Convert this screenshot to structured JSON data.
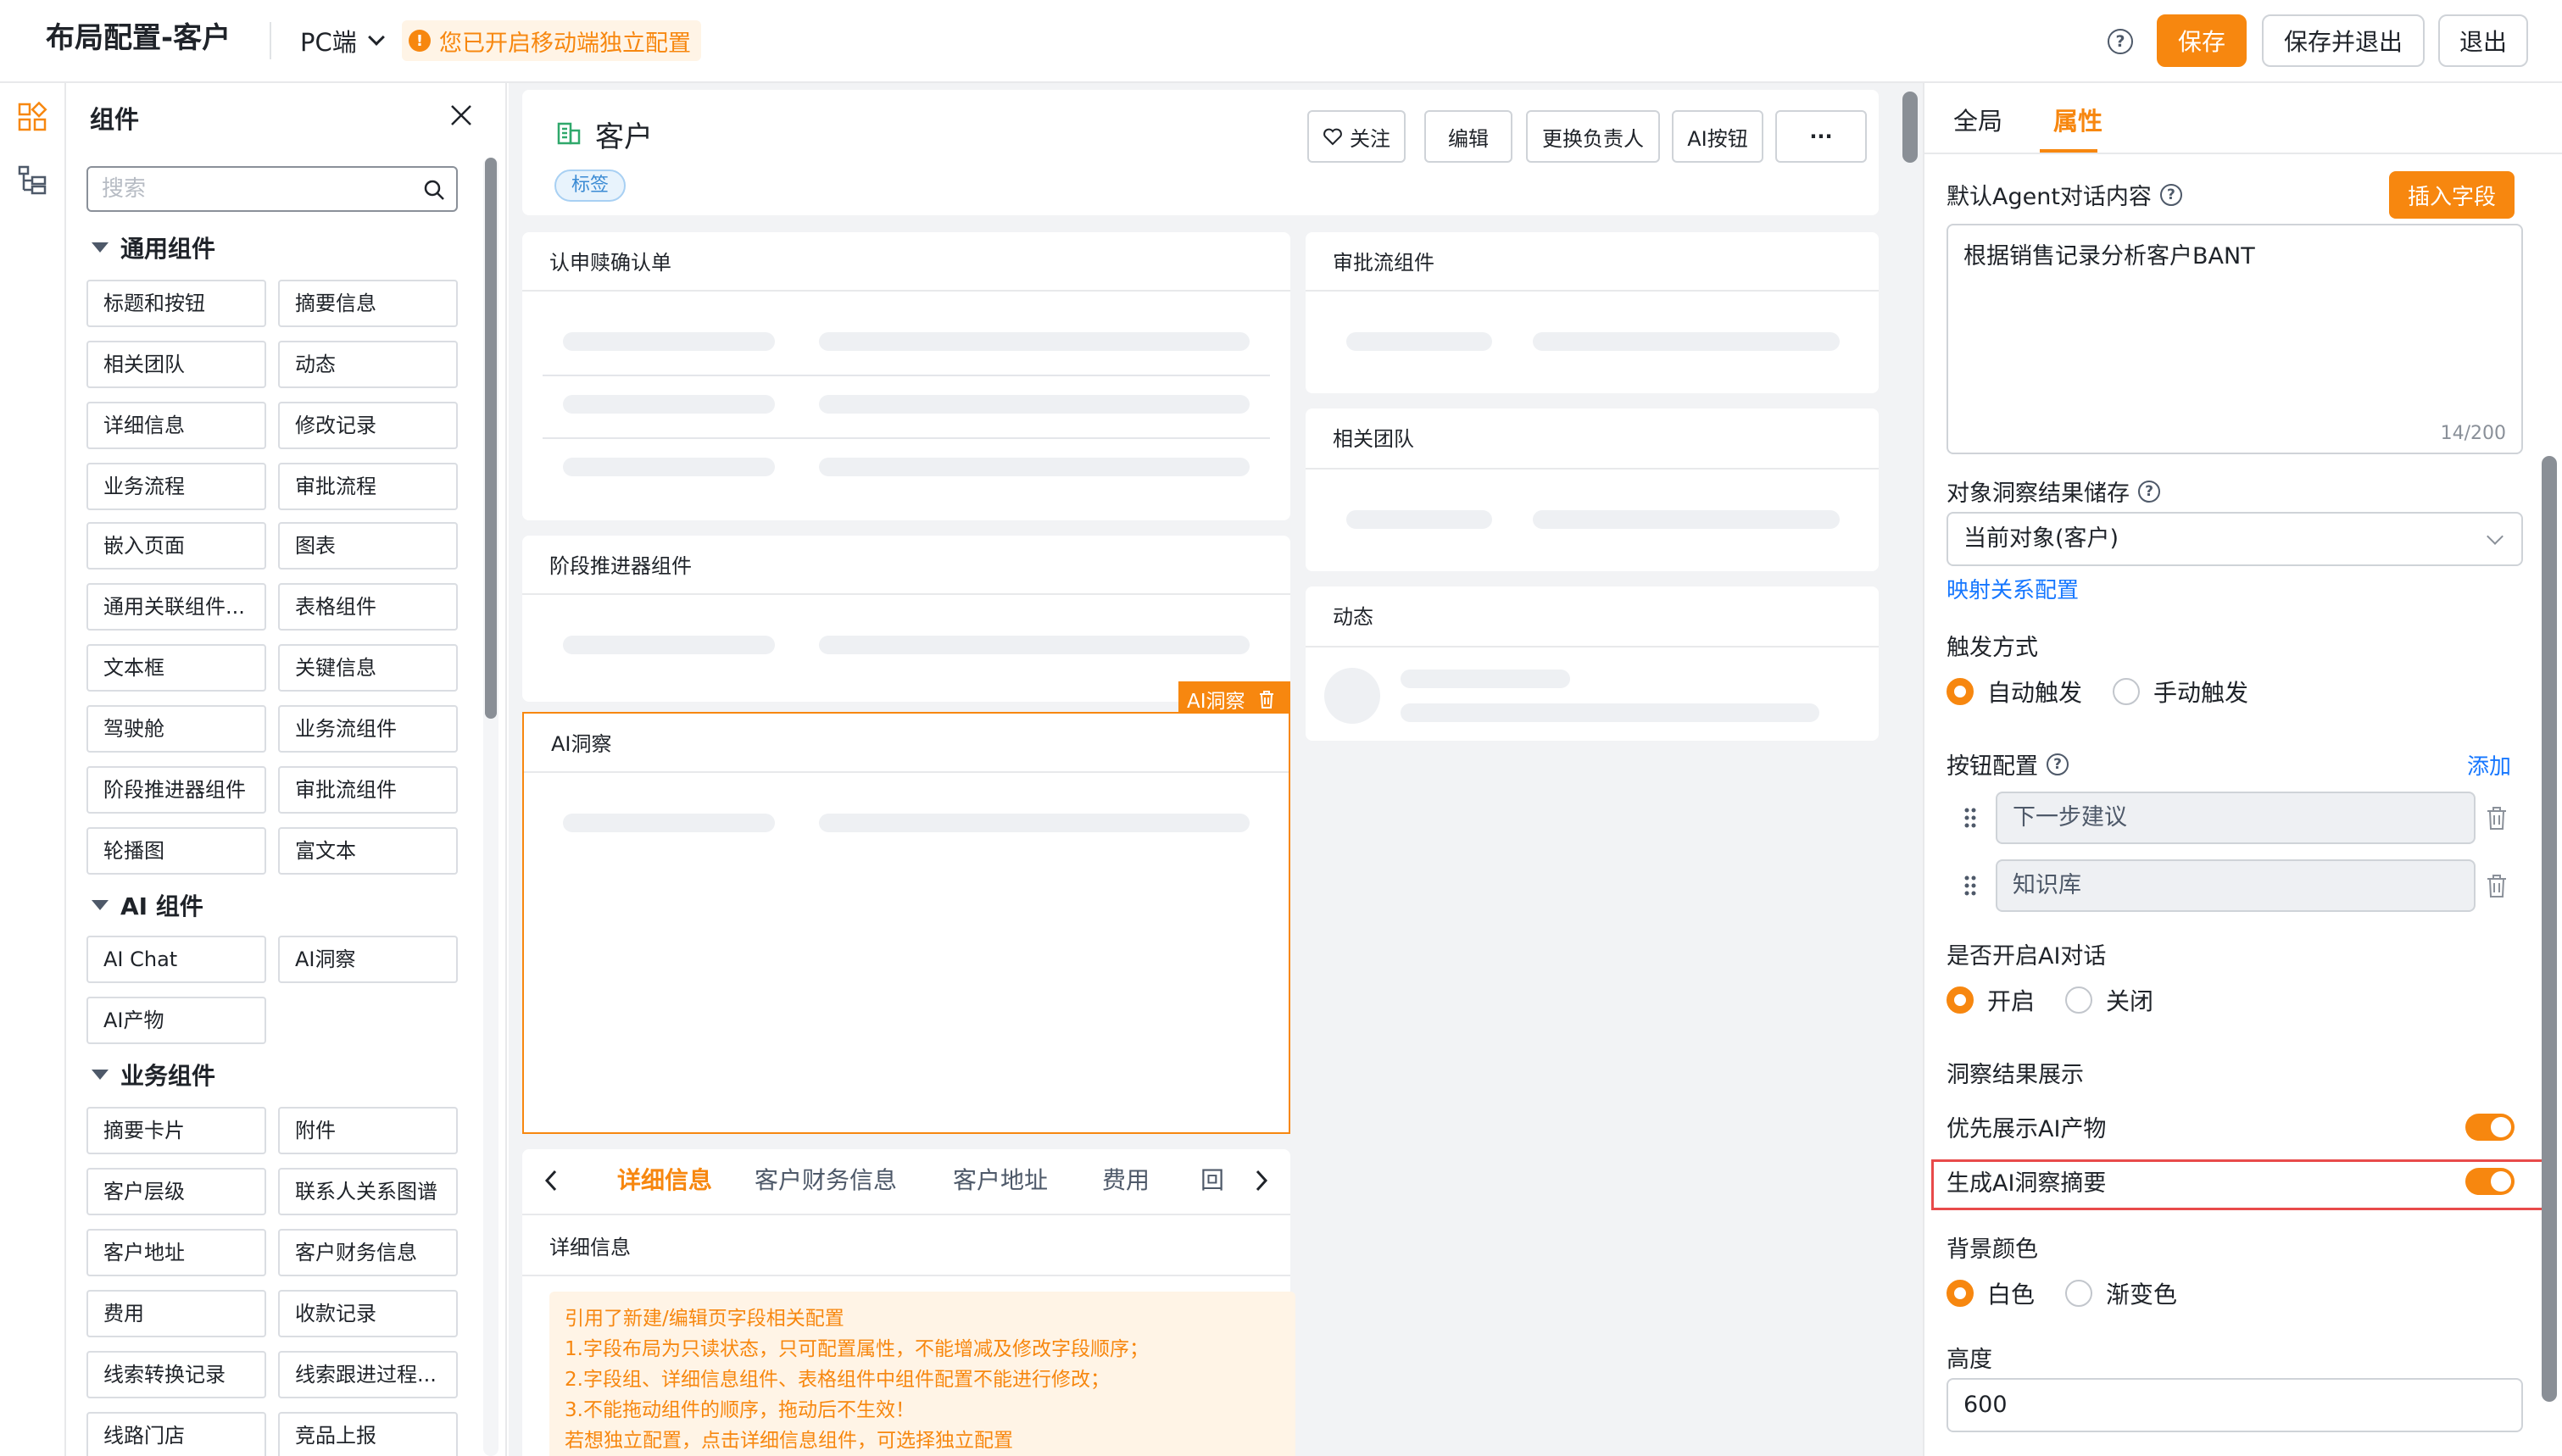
{
  "header": {
    "title": "布局配置-客户",
    "platform": "PC端",
    "mobile_notice": "您已开启移动端独立配置",
    "help_icon": "?",
    "save_label": "保存",
    "save_exit_label": "保存并退出",
    "exit_label": "退出"
  },
  "colors": {
    "accent": "#f7870f",
    "link": "#1677ff",
    "highlight_border": "#e84a4a",
    "tag_blue": "#3b8bd4"
  },
  "rail": {
    "icons": [
      "components-icon",
      "outline-tree-icon"
    ]
  },
  "components": {
    "title": "组件",
    "search_placeholder": "搜索",
    "groups": [
      {
        "name": "通用组件",
        "items": [
          {
            "label": "标题和按钮",
            "shaded": true
          },
          {
            "label": "摘要信息",
            "shaded": false
          },
          {
            "label": "相关团队",
            "shaded": true
          },
          {
            "label": "动态",
            "shaded": true
          },
          {
            "label": "详细信息",
            "shaded": true
          },
          {
            "label": "修改记录",
            "shaded": true
          },
          {
            "label": "业务流程",
            "shaded": true
          },
          {
            "label": "审批流程",
            "shaded": true
          },
          {
            "label": "嵌入页面",
            "shaded": false
          },
          {
            "label": "图表",
            "shaded": false
          },
          {
            "label": "通用关联组件...",
            "shaded": false
          },
          {
            "label": "表格组件",
            "shaded": false
          },
          {
            "label": "文本框",
            "shaded": false
          },
          {
            "label": "关键信息",
            "shaded": false
          },
          {
            "label": "驾驶舱",
            "shaded": false
          },
          {
            "label": "业务流组件",
            "shaded": false
          },
          {
            "label": "阶段推进器组件",
            "shaded": true
          },
          {
            "label": "审批流组件",
            "shaded": true
          },
          {
            "label": "轮播图",
            "shaded": false
          },
          {
            "label": "富文本",
            "shaded": false
          }
        ]
      },
      {
        "name": "AI 组件",
        "items": [
          {
            "label": "AI Chat",
            "shaded": false
          },
          {
            "label": "AI洞察",
            "shaded": false
          },
          {
            "label": "AI产物",
            "shaded": false
          }
        ]
      },
      {
        "name": "业务组件",
        "items": [
          {
            "label": "摘要卡片",
            "shaded": false
          },
          {
            "label": "附件",
            "shaded": true
          },
          {
            "label": "客户层级",
            "shaded": false
          },
          {
            "label": "联系人关系图谱",
            "shaded": false
          },
          {
            "label": "客户地址",
            "shaded": true
          },
          {
            "label": "客户财务信息",
            "shaded": false
          },
          {
            "label": "费用",
            "shaded": true
          },
          {
            "label": "收款记录",
            "shaded": false
          },
          {
            "label": "线索转换记录",
            "shaded": false
          },
          {
            "label": "线索跟进过程...",
            "shaded": false
          },
          {
            "label": "线路门店",
            "shaded": true
          },
          {
            "label": "竞品上报",
            "shaded": false
          }
        ]
      }
    ]
  },
  "canvas": {
    "record_title": "客户",
    "tag": "标签",
    "actions": {
      "follow": "关注",
      "edit": "编辑",
      "change_owner": "更换负责人",
      "ai_button": "AI按钮",
      "more": "···"
    },
    "left_cards": {
      "confirm": "认申赎确认单",
      "stage": "阶段推进器组件",
      "ai_insight": "AI洞察",
      "selected_badge": "AI洞察"
    },
    "right_cards": {
      "approval": "审批流组件",
      "team": "相关团队",
      "activity": "动态"
    },
    "tabs": [
      "详细信息",
      "客户财务信息",
      "客户地址",
      "费用",
      "回"
    ],
    "active_tab": "详细信息",
    "detail_title": "详细信息",
    "notice_lines": [
      "引用了新建/编辑页字段相关配置",
      "1.字段布局为只读状态，只可配置属性，不能增减及修改字段顺序；",
      "2.字段组、详细信息组件、表格组件中组件配置不能进行修改；",
      "3.不能拖动组件的顺序，拖动后不生效！",
      "若想独立配置，点击详细信息组件，可选择独立配置"
    ]
  },
  "properties": {
    "tabs": [
      "全局",
      "属性"
    ],
    "active_tab": "属性",
    "agent_label": "默认Agent对话内容",
    "insert_field": "插入字段",
    "agent_text": "根据销售记录分析客户BANT",
    "char_count": "14/200",
    "storage_label": "对象洞察结果储存",
    "storage_value": "当前对象(客户)",
    "mapping_link": "映射关系配置",
    "trigger_label": "触发方式",
    "trigger_options": [
      "自动触发",
      "手动触发"
    ],
    "trigger_selected": "自动触发",
    "buttons_label": "按钮配置",
    "add_link": "添加",
    "button_items": [
      "下一步建议",
      "知识库"
    ],
    "ai_chat_label": "是否开启AI对话",
    "ai_chat_options": [
      "开启",
      "关闭"
    ],
    "ai_chat_selected": "开启",
    "display_label": "洞察结果展示",
    "toggle_artifact_label": "优先展示AI产物",
    "toggle_artifact_on": true,
    "toggle_summary_label": "生成AI洞察摘要",
    "toggle_summary_on": true,
    "bg_label": "背景颜色",
    "bg_options": [
      "白色",
      "渐变色"
    ],
    "bg_selected": "白色",
    "height_label": "高度",
    "height_value": "600"
  }
}
